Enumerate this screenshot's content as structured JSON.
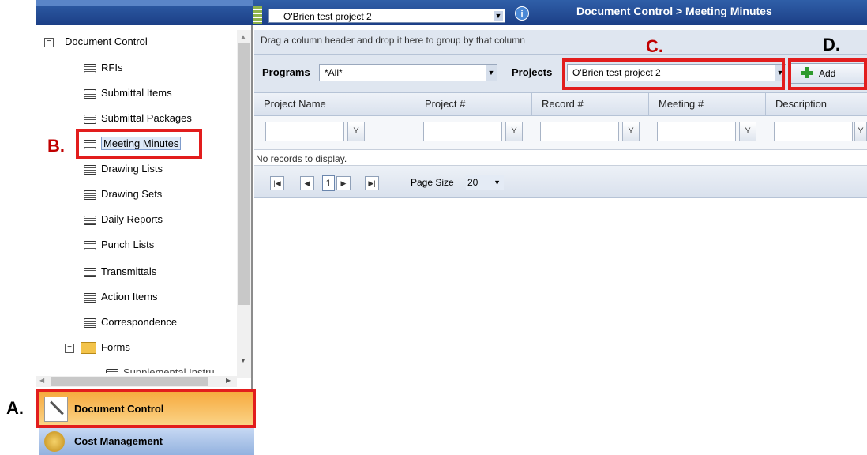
{
  "topbar": {
    "project_select_value": "O'Brien test project 2",
    "breadcrumb": "Document Control > Meeting Minutes"
  },
  "sidebar": {
    "root_label": "Document Control",
    "items": [
      {
        "label": "RFIs"
      },
      {
        "label": "Submittal Items"
      },
      {
        "label": "Submittal Packages"
      },
      {
        "label": "Meeting Minutes"
      },
      {
        "label": "Drawing Lists"
      },
      {
        "label": "Drawing Sets"
      },
      {
        "label": "Daily Reports"
      },
      {
        "label": "Punch Lists"
      },
      {
        "label": "Transmittals"
      },
      {
        "label": "Action Items"
      },
      {
        "label": "Correspondence"
      }
    ],
    "forms_label": "Forms",
    "partial_item": "Supplemental Instru..."
  },
  "nav": {
    "document_control": "Document Control",
    "cost_management": "Cost Management"
  },
  "main": {
    "group_hint": "Drag a column header and drop it here to group by that column",
    "programs_label": "Programs",
    "programs_value": "*All*",
    "projects_label": "Projects",
    "projects_value": "O'Brien test project 2",
    "add_label": "Add",
    "columns": [
      "Project Name",
      "Project #",
      "Record #",
      "Meeting #",
      "Description"
    ],
    "no_records": "No records to display.",
    "pager": {
      "current_page": "1",
      "page_size_label": "Page Size",
      "page_size_value": "20"
    }
  },
  "annotations": {
    "a": "A.",
    "b": "B.",
    "c": "C.",
    "d": "D."
  },
  "colors": {
    "annotation_red": "#e21d1d",
    "topbar_blue": "#1c3f86",
    "nav_active_orange": "#f6a83a"
  }
}
